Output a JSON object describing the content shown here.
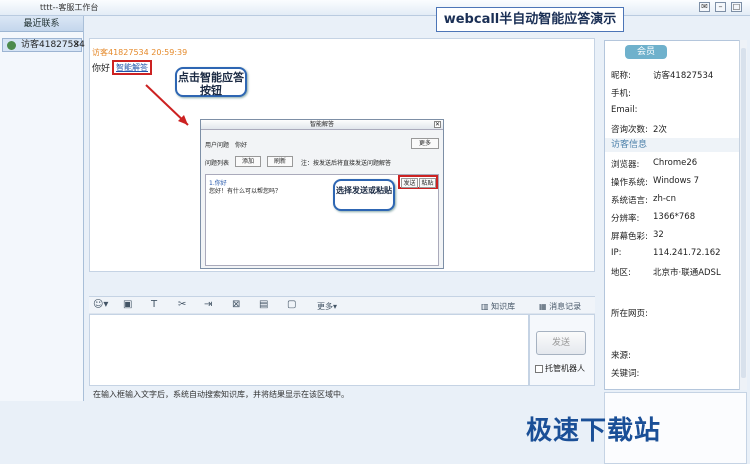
{
  "window": {
    "title": "tttt--客服工作台",
    "controls": [
      "✉",
      "–",
      "□"
    ]
  },
  "banner": {
    "text": "webcall半自动智能应答演示"
  },
  "sidebar": {
    "header": "最近联系",
    "items": [
      {
        "label": "访客41827534",
        "close": "✕"
      }
    ]
  },
  "chat": {
    "meta": "访客41827534 20:59:39",
    "message": "你好",
    "link": "智能解答"
  },
  "callouts": {
    "click_hint": "点击智能应答按钮",
    "select_hint": "选择发送或粘贴"
  },
  "dialog": {
    "title": "智能解答",
    "user_q_label": "用户问题",
    "user_q": "你好",
    "more": "更多",
    "list_label": "问题列表",
    "add": "添加",
    "refresh": "刷新",
    "note": "注：按发送后将直接发送问题解答",
    "q": "1.你好",
    "a": "您好！有什么可以帮您吗？",
    "send": "发送",
    "paste": "粘贴"
  },
  "toolbar": {
    "more": "更多",
    "knowledge": "知识库",
    "records": "消息记录"
  },
  "compose": {
    "send": "发送",
    "robot": "托管机器人",
    "status": "在输入框输入文字后，系统自动搜索知识库，并将结果显示在该区域中。"
  },
  "profile": {
    "member_btn": "会员",
    "fields": [
      {
        "k": "昵称:",
        "v": "访客41827534"
      },
      {
        "k": "手机:",
        "v": ""
      },
      {
        "k": "Email:",
        "v": ""
      },
      {
        "k": "咨询次数:",
        "v": "2次"
      }
    ],
    "section": "访客信息",
    "visitor": [
      {
        "k": "浏览器:",
        "v": "Chrome26"
      },
      {
        "k": "操作系统:",
        "v": "Windows 7"
      },
      {
        "k": "系统语言:",
        "v": "zh-cn"
      },
      {
        "k": "分辨率:",
        "v": "1366*768"
      },
      {
        "k": "屏幕色彩:",
        "v": "32"
      },
      {
        "k": "IP:",
        "v": "114.241.72.162"
      },
      {
        "k": "地区:",
        "v": "北京市·联通ADSL"
      },
      {
        "k": "所在网页:",
        "v": ""
      },
      {
        "k": "来源:",
        "v": ""
      },
      {
        "k": "关键词:",
        "v": ""
      }
    ]
  },
  "watermark": "极速下载站",
  "colors": {
    "accent": "#2e66b3",
    "callout_border": "#2e66b3",
    "highlight": "#cc2222",
    "member": "#6fb1cc"
  }
}
